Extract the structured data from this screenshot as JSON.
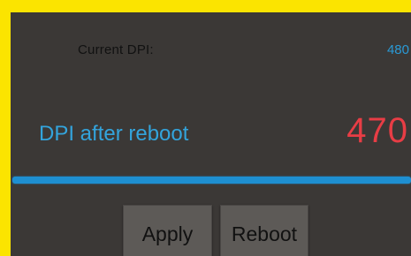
{
  "current_dpi": {
    "label": "Current DPI:",
    "value": "480"
  },
  "dpi_after_reboot": {
    "label": "DPI after reboot",
    "value": "470"
  },
  "slider": {
    "level_fraction": 1.0
  },
  "buttons": {
    "apply_label": "Apply",
    "reboot_label": "Reboot"
  },
  "colors": {
    "frame": "#fbe400",
    "background": "#3b3836",
    "accent_blue": "#33a4dc",
    "value_red": "#e83d45",
    "button": "#5d5a57"
  }
}
